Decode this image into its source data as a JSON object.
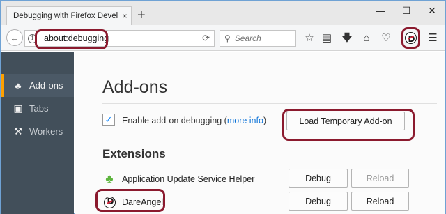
{
  "tab": {
    "title": "Debugging with Firefox Devel…",
    "close": "×"
  },
  "new_tab": "+",
  "window_controls": {
    "minimize": "—",
    "maximize": "☐",
    "close": "✕"
  },
  "nav": {
    "url": "about:debugging",
    "search_placeholder": "Search"
  },
  "toolbar_icons": [
    "bookmark-star-icon",
    "reading-list-icon",
    "download-icon",
    "home-icon",
    "pocket-icon",
    "dareangel-icon",
    "menu-icon"
  ],
  "sidebar": {
    "items": [
      {
        "label": "Add-ons",
        "icon": "puzzle-icon",
        "active": true
      },
      {
        "label": "Tabs",
        "icon": "tabs-icon",
        "active": false
      },
      {
        "label": "Workers",
        "icon": "workers-icon",
        "active": false
      }
    ]
  },
  "main": {
    "title": "Add-ons",
    "enable_label": "Enable add-on debugging (",
    "more_info": "more info",
    "enable_suffix": ")",
    "load_button": "Load Temporary Add-on",
    "extensions_heading": "Extensions",
    "extensions": [
      {
        "name": "Application Update Service Helper",
        "icon": "puzzle-icon",
        "debug": "Debug",
        "reload": "Reload",
        "reload_enabled": false
      },
      {
        "name": "DareAngel",
        "icon": "dareangel-icon",
        "debug": "Debug",
        "reload": "Reload",
        "reload_enabled": true
      }
    ]
  },
  "colors": {
    "accent": "#ffa000",
    "annotation": "#8b1a2e",
    "sidebar_bg": "#424f5a",
    "link": "#0a72d8"
  }
}
